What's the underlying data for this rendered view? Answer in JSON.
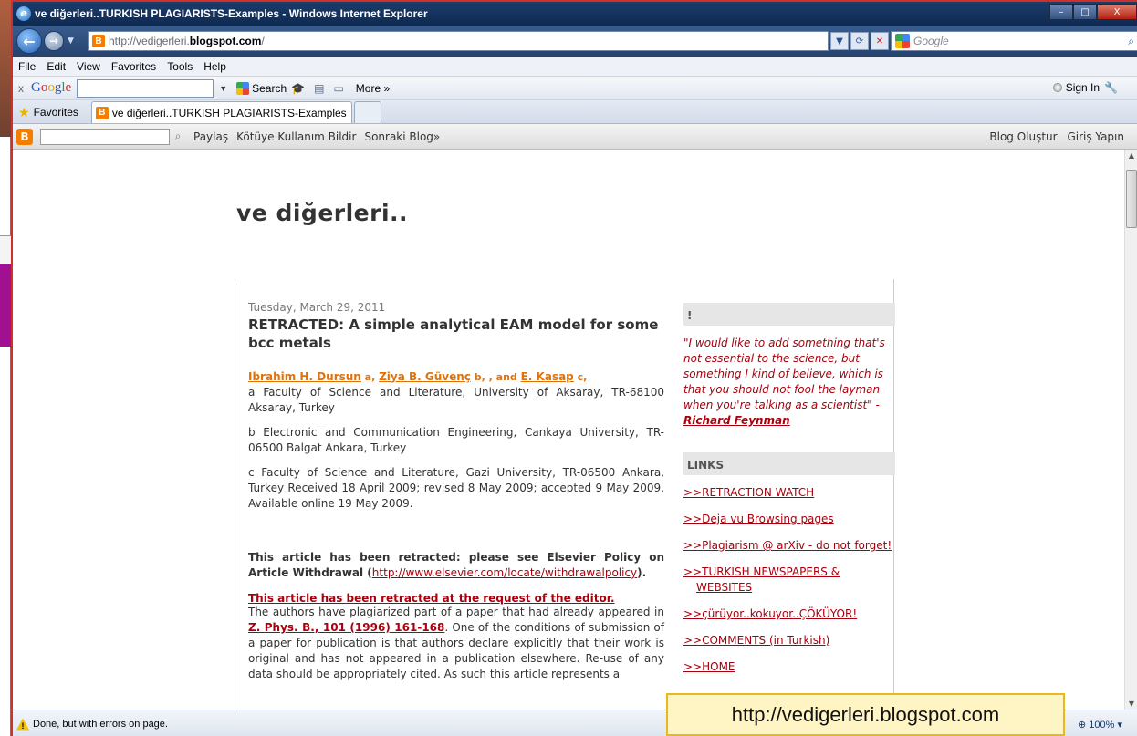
{
  "window": {
    "title": "ve diğerleri..TURKISH PLAGIARISTS-Examples - Windows Internet Explorer",
    "minimize_glyph": "–",
    "maximize_glyph": "□",
    "close_glyph": "X"
  },
  "address_bar": {
    "url_prefix": "http://vedigerleri.",
    "url_domain": "blogspot.com",
    "url_suffix": "/",
    "search_placeholder": "Google"
  },
  "menu": [
    "File",
    "Edit",
    "View",
    "Favorites",
    "Tools",
    "Help"
  ],
  "google_toolbar": {
    "close_label": "x",
    "search_label": "Search",
    "more_label": "More »",
    "signin_label": "Sign In"
  },
  "tabs": {
    "favorites_label": "Favorites",
    "active_tab_label": "ve diğerleri..TURKISH PLAGIARISTS-Examples"
  },
  "blogger_navbar": {
    "links": [
      "Paylaş",
      "Kötüye Kullanım Bildir",
      "Sonraki Blog»"
    ],
    "right_links": [
      "Blog Oluştur",
      "Giriş Yapın"
    ]
  },
  "blog": {
    "title": "ve diğerleri..",
    "post": {
      "date": "Tuesday, March 29, 2011",
      "title": "RETRACTED: A simple analytical EAM model for some bcc metals",
      "authors": [
        {
          "name": "Ibrahim H. Dursun",
          "sup": " a, "
        },
        {
          "name": "Ziya B. Güvenç",
          "sup": " b, , and "
        },
        {
          "name": "E. Kasap",
          "sup": " c,"
        }
      ],
      "affiliation_a": "a Faculty of Science and Literature, University of Aksaray, TR-68100 Aksaray, Turkey",
      "affiliation_b": "b Electronic and Communication Engineering, Cankaya University, TR-06500 Balgat Ankara, Turkey",
      "affiliation_c": "c Faculty of Science and Literature, Gazi University, TR-06500 Ankara, Turkey Received 18 April 2009; revised 8 May 2009; accepted 9 May 2009. Available online 19 May 2009.",
      "notice_text": "This article has been retracted: please see Elsevier Policy on Article Withdrawal (",
      "notice_link": "http://www.elsevier.com/locate/withdrawalpolicy",
      "notice_end": ").",
      "editor_line": "This article has been retracted at the request of the editor.",
      "body_start": "The authors have plagiarized part of a paper that had already appeared in ",
      "body_link": "Z. Phys. B., 101 (1996) 161-168",
      "body_rest": ". One of the conditions of submission of a paper for publication is that authors declare explicitly that their work is original and has not appeared in a publication elsewhere. Re-use of any data should be appropriately cited. As such this article represents a"
    },
    "sidebar": {
      "quote_heading": "!",
      "quote_text": "\"I would like to add something that's not essential to the science, but something I kind of believe, which is that you should not fool the layman when you're talking as a scientist\" - ",
      "quote_author": "Richard Feynman",
      "links_heading": "LINKS",
      "links": [
        ">>RETRACTION WATCH",
        ">>Deja vu Browsing pages",
        ">>Plagiarism @ arXiv - do not forget!",
        ">>TURKISH NEWSPAPERS &",
        "WEBSITES",
        ">>çürüyor..kokuyor..ÇÖKÜYOR!",
        ">>COMMENTS (in Turkish)",
        ">>HOME"
      ]
    }
  },
  "caption": "http://vedigerleri.blogspot.com",
  "status": {
    "text": "Done, but with errors on page.",
    "zoom": "100%"
  },
  "colors": {
    "link_red": "#a8000c",
    "author_orange": "#e0720a",
    "titlebar": "#0e2a52",
    "window_border": "#d0302a"
  }
}
